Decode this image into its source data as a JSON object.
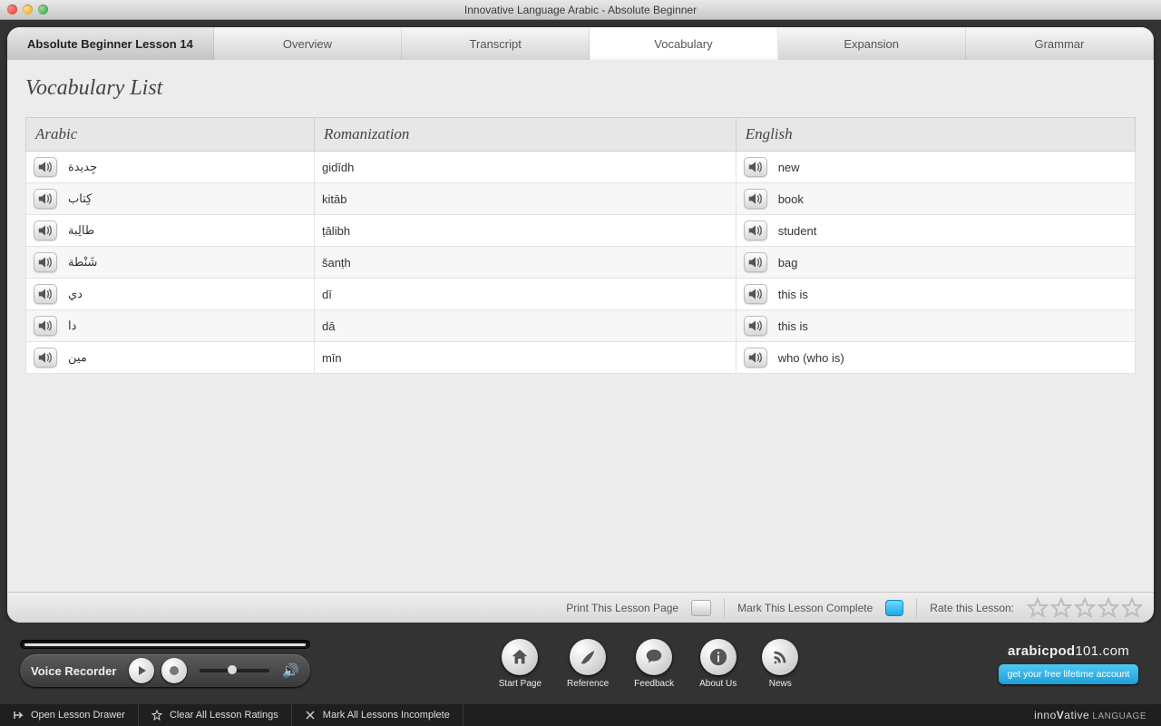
{
  "window": {
    "title": "Innovative Language Arabic - Absolute Beginner"
  },
  "tabs": {
    "lesson": "Absolute Beginner Lesson 14",
    "overview": "Overview",
    "transcript": "Transcript",
    "vocabulary": "Vocabulary",
    "expansion": "Expansion",
    "grammar": "Grammar"
  },
  "heading": "Vocabulary List",
  "columns": {
    "arabic": "Arabic",
    "romanization": "Romanization",
    "english": "English"
  },
  "rows": [
    {
      "arabic": "جِديدة",
      "roman": "gidīdh",
      "english": "new"
    },
    {
      "arabic": "كِتاب",
      "roman": "kitāb",
      "english": "book"
    },
    {
      "arabic": "طالِبة",
      "roman": "ṭālibh",
      "english": "student"
    },
    {
      "arabic": "شَنْطة",
      "roman": "šanṭh",
      "english": "bag"
    },
    {
      "arabic": "دي",
      "roman": "dī",
      "english": "this is"
    },
    {
      "arabic": "دا",
      "roman": "dā",
      "english": "this is"
    },
    {
      "arabic": "مين",
      "roman": "mīn",
      "english": "who (who is)"
    }
  ],
  "footer": {
    "print": "Print This Lesson Page",
    "mark": "Mark This Lesson Complete",
    "rate": "Rate this Lesson:"
  },
  "recorder": {
    "label": "Voice Recorder"
  },
  "nav": {
    "start": "Start Page",
    "reference": "Reference",
    "feedback": "Feedback",
    "about": "About Us",
    "news": "News"
  },
  "brand": {
    "site_bold": "arabicpod",
    "site_rest": "101.com",
    "cta": "get your free lifetime account"
  },
  "status": {
    "drawer": "Open Lesson Drawer",
    "clear": "Clear All Lesson Ratings",
    "markinc": "Mark All Lessons Incomplete",
    "brand_pre": "inno",
    "brand_v": "V",
    "brand_mid": "ative",
    "brand_post": " LANGUAGE"
  }
}
